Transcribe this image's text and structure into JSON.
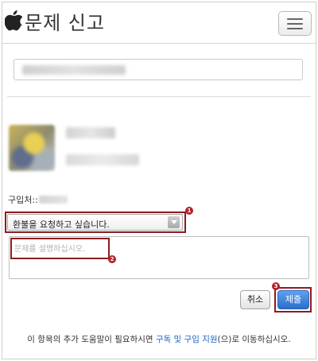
{
  "header": {
    "title": "문제 신고",
    "logo_icon": "apple-logo-icon",
    "menu_icon": "hamburger-menu-icon"
  },
  "purchase": {
    "label": "구입처::"
  },
  "form": {
    "reason_selected": "환불을 요청하고 싶습니다.",
    "description_placeholder": "문제를 설명하십시오.",
    "cancel_label": "취소",
    "submit_label": "제출"
  },
  "annotations": {
    "badge_1": "1",
    "badge_2": "2",
    "badge_3": "3",
    "highlight_color": "#8b1c22"
  },
  "footer": {
    "text_before": "이 항목의 추가 도움말이 필요하시면 ",
    "link_label": "구독 및 구입 지원",
    "text_after": "(으)로 이동하십시오."
  },
  "colors": {
    "submit_button": "#2a6ecc",
    "link": "#1f63c6",
    "badge": "#b3222a"
  }
}
